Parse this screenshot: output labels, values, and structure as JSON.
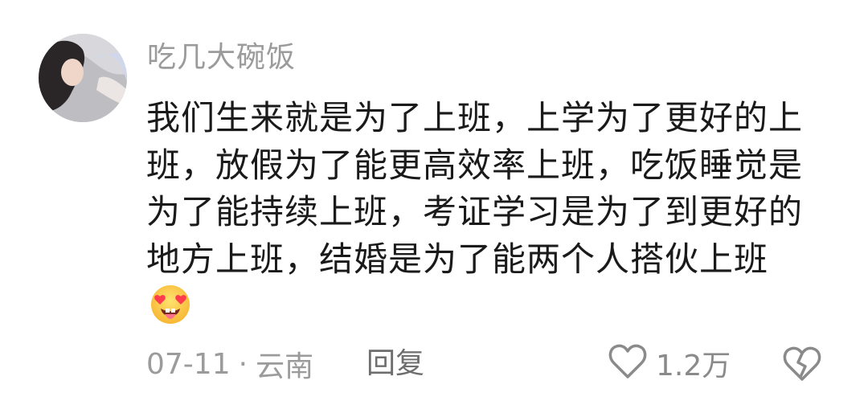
{
  "comment": {
    "username": "吃几大碗饭",
    "text": "我们生来就是为了上班，上学为了更好的上班，放假为了能更高效率上班，吃饭睡觉是为了能持续上班，考证学习是为了到更好的地方上班，结婚是为了能两个人搭伙上班",
    "emoji": "heart-eyes-tongue-emoji",
    "date": "07-11",
    "separator": "·",
    "location": "云南",
    "reply_label": "回复",
    "like_count": "1.2万",
    "icons": {
      "like": "heart-outline-icon",
      "dislike": "broken-heart-icon"
    },
    "colors": {
      "text": "#1a1a1a",
      "muted": "#9b9b9b"
    }
  }
}
